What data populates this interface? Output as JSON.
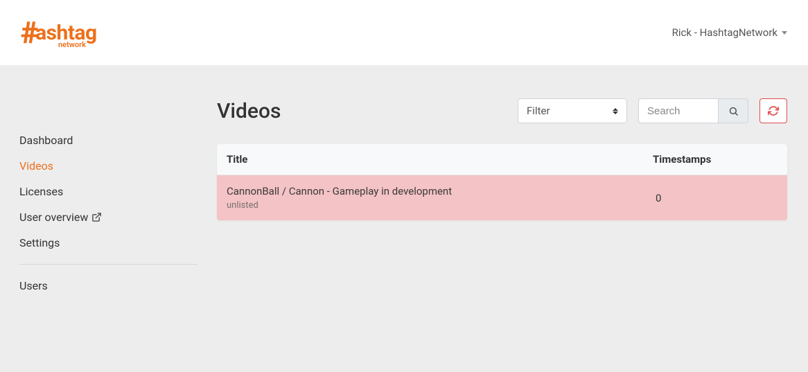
{
  "header": {
    "logo_text": "ashtag",
    "logo_sub": "network",
    "user_label": "Rick - HashtagNetwork"
  },
  "sidebar": {
    "items": [
      {
        "label": "Dashboard",
        "active": false
      },
      {
        "label": "Videos",
        "active": true
      },
      {
        "label": "Licenses",
        "active": false
      },
      {
        "label": "User overview",
        "active": false,
        "external": true
      },
      {
        "label": "Settings",
        "active": false
      }
    ],
    "items2": [
      {
        "label": "Users",
        "active": false
      }
    ]
  },
  "main": {
    "title": "Videos",
    "filter_label": "Filter",
    "search_placeholder": "Search",
    "columns": {
      "title": "Title",
      "timestamps": "Timestamps"
    },
    "rows": [
      {
        "title": "CannonBall / Cannon - Gameplay in development",
        "sub": "unlisted",
        "timestamps": "0"
      }
    ]
  }
}
